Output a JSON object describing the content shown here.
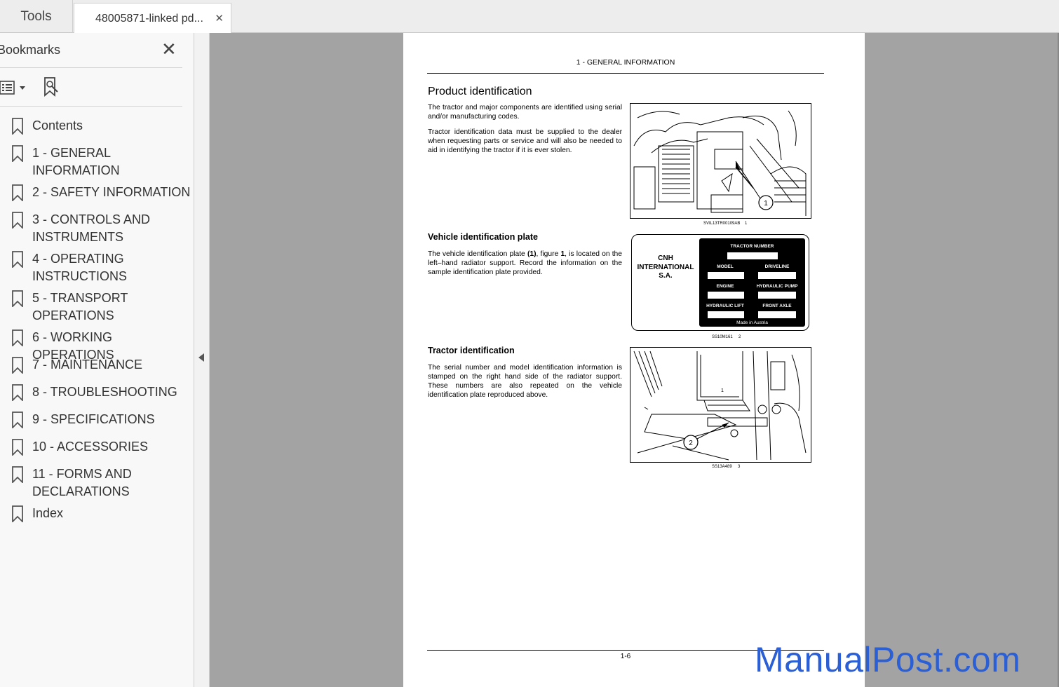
{
  "tabs": {
    "tools_label": "Tools",
    "doc_label": "48005871-linked pd...",
    "close_glyph": "✕"
  },
  "sidebar": {
    "title": "Bookmarks",
    "close_glyph": "✕",
    "items": [
      "Contents",
      "1 - GENERAL INFORMATION",
      "2 - SAFETY INFORMATION",
      "3 - CONTROLS AND INSTRUMENTS",
      "4 - OPERATING INSTRUCTIONS",
      "5 - TRANSPORT OPERATIONS",
      "6 - WORKING OPERATIONS",
      "7 - MAINTENANCE",
      "8 - TROUBLESHOOTING",
      "9 - SPECIFICATIONS",
      "10 - ACCESSORIES",
      "11 - FORMS AND DECLARATIONS",
      "Index"
    ]
  },
  "page": {
    "header": "1 - GENERAL INFORMATION",
    "title": "Product identification",
    "para1": "The tractor and major components are identified using serial and/or manufacturing codes.",
    "para2": "Tractor identification data must be supplied to the dealer when requesting parts or service and will also be needed to aid in identifying the tractor if it is ever stolen.",
    "fig1_caption": "SVIL13TR00109AB",
    "fig1_num": "1",
    "fig1_callout": "1",
    "section2_title": "Vehicle identification plate",
    "para3_a": "The vehicle identification plate ",
    "para3_b": "(1)",
    "para3_c": ", figure ",
    "para3_d": "1",
    "para3_e": ", is located on the left–hand radiator support. Record the information on the sample identification plate provided.",
    "plate": {
      "maker_line1": "CNH",
      "maker_line2": "INTERNATIONAL",
      "maker_line3": "S.A.",
      "tractor_number": "TRACTOR NUMBER",
      "model": "MODEL",
      "driveline": "DRIVELINE",
      "engine": "ENGINE",
      "hydraulic_pump": "HYDRAULIC PUMP",
      "hydraulic_lift": "HYDRAULIC LIFT",
      "front_axle": "FRONT AXLE",
      "made_in": "Made in Austria"
    },
    "fig2_caption": "SS10M161",
    "fig2_num": "2",
    "section3_title": "Tractor identification",
    "para4": "The serial number and model identification information is stamped on the right hand side of the radiator support. These numbers are also repeated on the vehicle identification plate reproduced above.",
    "fig3_caption": "SS13A489",
    "fig3_num": "3",
    "fig3_callout_2": "2",
    "fig3_callout_1": "1",
    "page_number": "1-6"
  },
  "watermark": "ManualPost.com"
}
